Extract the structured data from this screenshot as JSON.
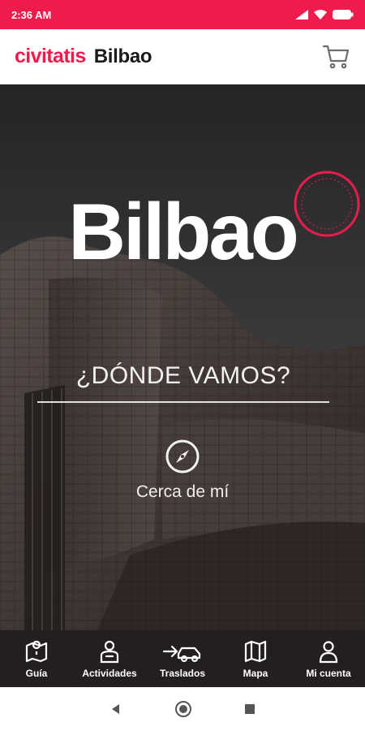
{
  "status_bar": {
    "time": "2:36 AM"
  },
  "header": {
    "brand": "civitatis",
    "title": "Bilbao",
    "cart_icon": "cart-icon"
  },
  "hero": {
    "title": "Bilbao",
    "search_placeholder": "¿DÓNDE VAMOS?",
    "near_me_label": "Cerca de mí",
    "near_me_icon": "compass-icon",
    "seal_icon": "seal-stamp-icon"
  },
  "bottom_nav": {
    "items": [
      {
        "label": "Guía",
        "icon": "map-pin-icon"
      },
      {
        "label": "Actividades",
        "icon": "guide-person-icon"
      },
      {
        "label": "Traslados",
        "icon": "transfer-car-icon"
      },
      {
        "label": "Mapa",
        "icon": "map-icon"
      },
      {
        "label": "Mi cuenta",
        "icon": "user-icon"
      }
    ]
  },
  "colors": {
    "brand": "#ee1c4c",
    "nav_bg": "#231f20"
  }
}
